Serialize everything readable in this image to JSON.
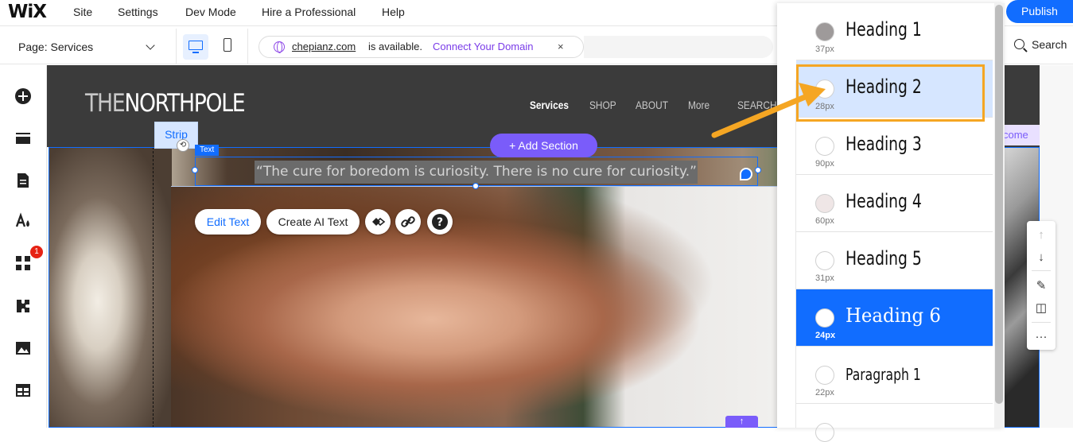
{
  "topbar": {
    "logo": "WiX",
    "nav": [
      "Site",
      "Settings",
      "Dev Mode",
      "Hire a Professional",
      "Help"
    ],
    "publish": "Publish",
    "search": "Search"
  },
  "toolbar": {
    "page_label": "Page: Services",
    "domain": "chepianz.com",
    "available": "is available.",
    "connect": "Connect Your Domain",
    "close": "×"
  },
  "sidebar": {
    "badge_count": "1"
  },
  "site": {
    "logo_light": "THE",
    "logo_bold": "NORTHPOLE",
    "nav": [
      "Services",
      "SHOP",
      "ABOUT",
      "More",
      "SEARCH"
    ],
    "quote": "“The cure for boredom is curiosity. There is no cure for curiosity.”",
    "welcome_partial": "come"
  },
  "editor": {
    "strip_label": "Strip",
    "text_tag": "Text",
    "add_section": "+ Add Section",
    "edit_text": "Edit Text",
    "create_ai_text": "Create AI Text"
  },
  "text_styles": [
    {
      "name": "Heading 1",
      "size": "37px",
      "dot": "#9e9a9a"
    },
    {
      "name": "Heading 2",
      "size": "28px",
      "dot": "#ffffff"
    },
    {
      "name": "Heading 3",
      "size": "90px",
      "dot": "#ffffff"
    },
    {
      "name": "Heading 4",
      "size": "60px",
      "dot": "#efe6e6"
    },
    {
      "name": "Heading 5",
      "size": "31px",
      "dot": "#ffffff"
    },
    {
      "name": "Heading 6",
      "size": "24px",
      "dot": "#ffffff"
    },
    {
      "name": "Paragraph 1",
      "size": "22px",
      "dot": "#ffffff"
    }
  ],
  "colors": {
    "accent": "#116dff",
    "highlight": "#f5a623",
    "add_section": "#7a5cfa"
  }
}
